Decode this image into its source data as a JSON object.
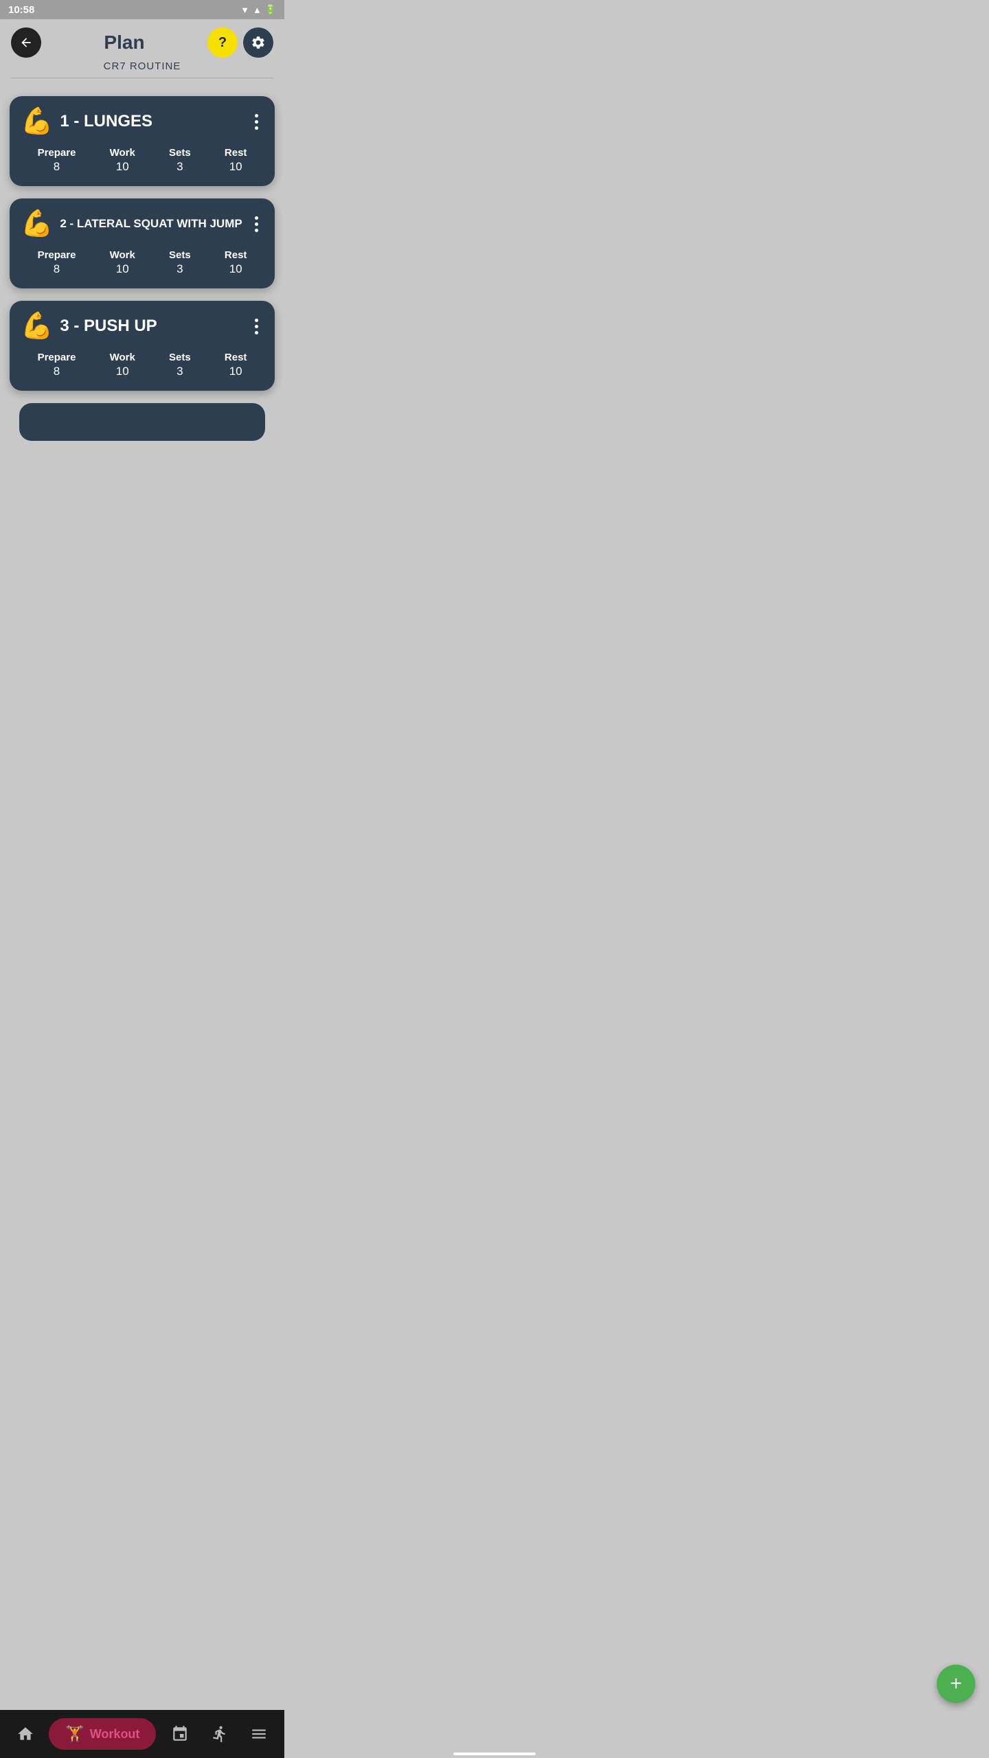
{
  "status": {
    "time": "10:58"
  },
  "header": {
    "title": "Plan",
    "subtitle": "CR7 ROUTINE"
  },
  "exercises": [
    {
      "id": 1,
      "emoji": "💪",
      "name": "1 - LUNGES",
      "prepare_label": "Prepare",
      "prepare_value": "8",
      "work_label": "Work",
      "work_value": "10",
      "sets_label": "Sets",
      "sets_value": "3",
      "rest_label": "Rest",
      "rest_value": "10"
    },
    {
      "id": 2,
      "emoji": "💪",
      "name": "2 - LATERAL SQUAT WITH JUMP",
      "prepare_label": "Prepare",
      "prepare_value": "8",
      "work_label": "Work",
      "work_value": "10",
      "sets_label": "Sets",
      "sets_value": "3",
      "rest_label": "Rest",
      "rest_value": "10"
    },
    {
      "id": 3,
      "emoji": "💪",
      "name": "3 - PUSH UP",
      "prepare_label": "Prepare",
      "prepare_value": "8",
      "work_label": "Work",
      "work_value": "10",
      "sets_label": "Sets",
      "sets_value": "3",
      "rest_label": "Rest",
      "rest_value": "10"
    }
  ],
  "fab": {
    "label": "+"
  },
  "nav": {
    "home_label": "Home",
    "workout_label": "Workout",
    "calendar_label": "Calendar",
    "activity_label": "Activity",
    "menu_label": "Menu"
  }
}
